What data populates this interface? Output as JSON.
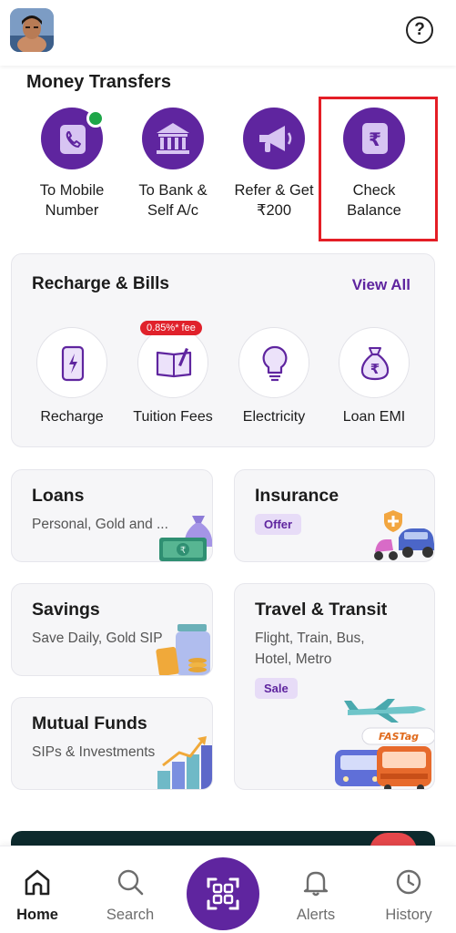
{
  "header": {
    "avatar_icon": "profile-photo",
    "help_glyph": "?"
  },
  "money_transfers": {
    "title": "Money Transfers",
    "items": [
      {
        "line1": "To Mobile",
        "line2": "Number",
        "icon": "phone-icon"
      },
      {
        "line1": "To Bank &",
        "line2": "Self A/c",
        "icon": "bank-icon"
      },
      {
        "line1": "Refer & Get",
        "line2": "₹200",
        "icon": "megaphone-icon"
      },
      {
        "line1": "Check",
        "line2": "Balance",
        "icon": "rupee-card-icon"
      }
    ]
  },
  "recharge_bills": {
    "title": "Recharge & Bills",
    "view_all": "View All",
    "fee_badge": "0.85%* fee",
    "items": [
      {
        "label": "Recharge",
        "icon": "mobile-recharge-icon"
      },
      {
        "label": "Tuition Fees",
        "icon": "book-icon"
      },
      {
        "label": "Electricity",
        "icon": "bulb-icon"
      },
      {
        "label": "Loan EMI",
        "icon": "money-bag-icon"
      }
    ]
  },
  "tiles": {
    "loans": {
      "title": "Loans",
      "subtitle": "Personal, Gold and ..."
    },
    "insurance": {
      "title": "Insurance",
      "badge": "Offer"
    },
    "savings": {
      "title": "Savings",
      "subtitle": "Save Daily, Gold SIP"
    },
    "travel": {
      "title": "Travel & Transit",
      "subtitle": "Flight, Train, Bus, Hotel, Metro",
      "badge": "Sale",
      "fastag_text": "FASTag"
    },
    "mutual_funds": {
      "title": "Mutual Funds",
      "subtitle": "SIPs & Investments"
    }
  },
  "bottom_nav": {
    "items": [
      {
        "label": "Home",
        "icon": "home-icon",
        "active": true
      },
      {
        "label": "Search",
        "icon": "search-icon"
      },
      {
        "label": "",
        "icon": "qr-scan-icon"
      },
      {
        "label": "Alerts",
        "icon": "bell-icon"
      },
      {
        "label": "History",
        "icon": "clock-icon"
      }
    ]
  },
  "colors": {
    "brand": "#5f259f",
    "highlight": "#e41e26",
    "fee_badge": "#e0212b",
    "online_dot": "#1ea648"
  }
}
